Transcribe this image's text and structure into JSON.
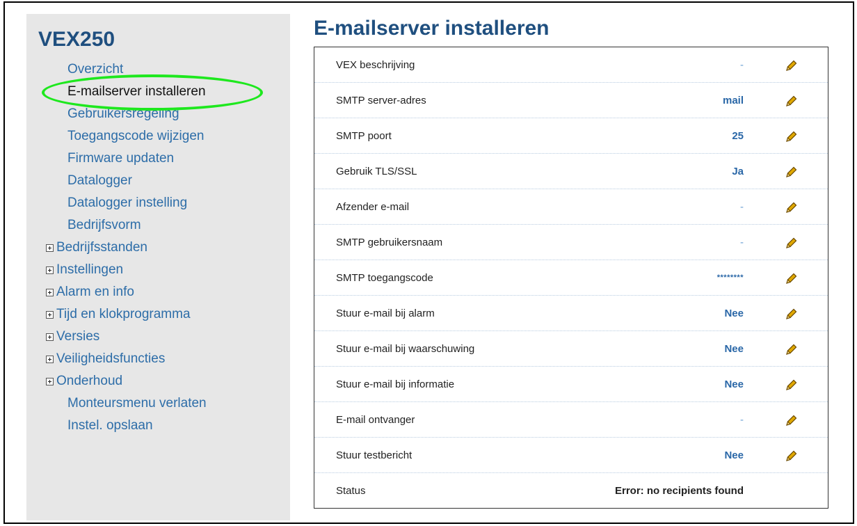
{
  "brand": "VEX250",
  "nav": {
    "items": [
      {
        "label": "Overzicht"
      },
      {
        "label": "E-mailserver installeren"
      },
      {
        "label": "Gebruikersregeling"
      },
      {
        "label": "Toegangscode wijzigen"
      },
      {
        "label": "Firmware updaten"
      },
      {
        "label": "Datalogger"
      },
      {
        "label": "Datalogger instelling"
      },
      {
        "label": "Bedrijfsvorm"
      },
      {
        "label": "Bedrijfsstanden"
      },
      {
        "label": "Instellingen"
      },
      {
        "label": "Alarm en info"
      },
      {
        "label": "Tijd en klokprogramma"
      },
      {
        "label": "Versies"
      },
      {
        "label": "Veiligheidsfuncties"
      },
      {
        "label": "Onderhoud"
      },
      {
        "label": "Monteursmenu verlaten"
      },
      {
        "label": "Instel. opslaan"
      }
    ]
  },
  "page": {
    "title": "E-mailserver installeren"
  },
  "settings": [
    {
      "label": "VEX beschrijving",
      "value": "-"
    },
    {
      "label": "SMTP server-adres",
      "value": "mail"
    },
    {
      "label": "SMTP poort",
      "value": "25"
    },
    {
      "label": "Gebruik TLS/SSL",
      "value": "Ja"
    },
    {
      "label": "Afzender e-mail",
      "value": "-"
    },
    {
      "label": "SMTP gebruikersnaam",
      "value": "-"
    },
    {
      "label": "SMTP toegangscode",
      "value": "********"
    },
    {
      "label": "Stuur e-mail bij alarm",
      "value": "Nee"
    },
    {
      "label": "Stuur e-mail bij waarschuwing",
      "value": "Nee"
    },
    {
      "label": "Stuur e-mail bij informatie",
      "value": "Nee"
    },
    {
      "label": "E-mail ontvanger",
      "value": "-"
    },
    {
      "label": "Stuur testbericht",
      "value": "Nee"
    },
    {
      "label": "Status",
      "value": "Error: no recipients found"
    }
  ],
  "colors": {
    "accent": "#2d6da8",
    "heading": "#1f4f7f",
    "highlight": "#1ee81e",
    "edit_icon": "#e0a800"
  }
}
